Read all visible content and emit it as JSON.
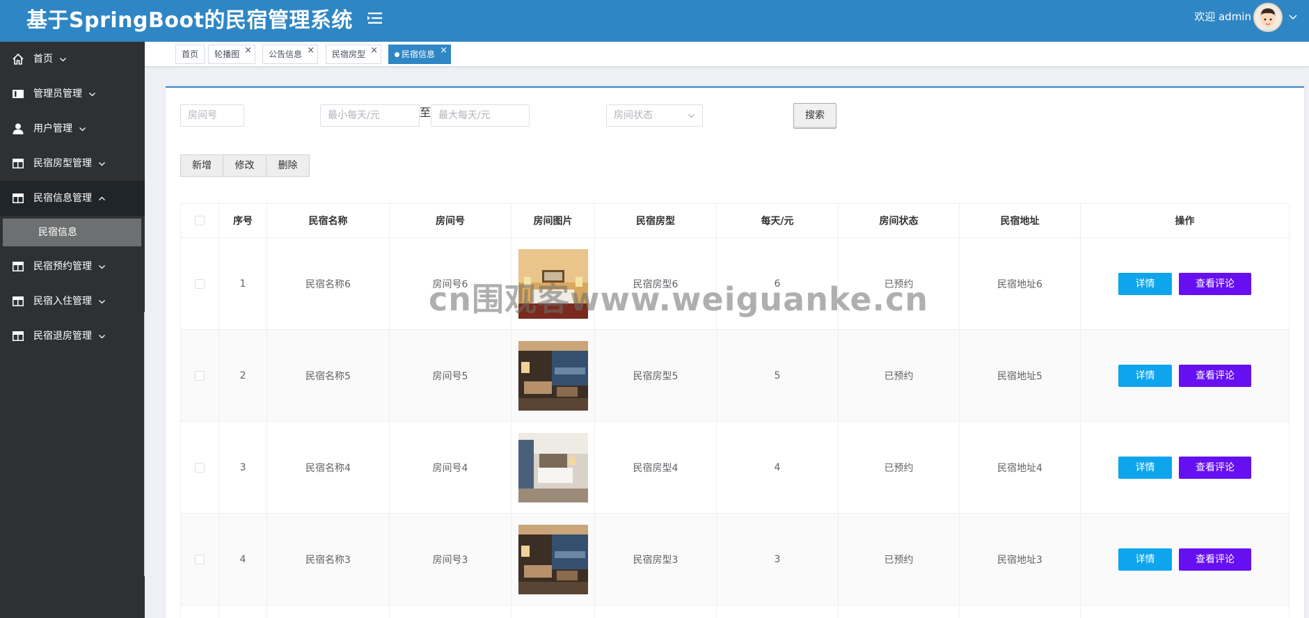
{
  "app": {
    "title": "基于SpringBoot的民宿管理系统",
    "welcome": "欢迎 admin"
  },
  "sidebar": {
    "items": [
      {
        "label": "首页",
        "icon": "home-icon"
      },
      {
        "label": "管理员管理",
        "icon": "card-icon"
      },
      {
        "label": "用户管理",
        "icon": "user-icon"
      },
      {
        "label": "民宿房型管理",
        "icon": "table-icon"
      },
      {
        "label": "民宿信息管理",
        "icon": "table-icon"
      },
      {
        "label": "民宿预约管理",
        "icon": "table-icon"
      },
      {
        "label": "民宿入住管理",
        "icon": "table-icon"
      },
      {
        "label": "民宿退房管理",
        "icon": "table-icon"
      }
    ],
    "sub_item": "民宿信息"
  },
  "tags": [
    {
      "label": "首页",
      "closable": false
    },
    {
      "label": "轮播图",
      "closable": true
    },
    {
      "label": "公告信息",
      "closable": true
    },
    {
      "label": "民宿房型",
      "closable": true
    },
    {
      "label": "民宿信息",
      "closable": true,
      "active": true
    }
  ],
  "search": {
    "room_placeholder": "房间号",
    "min_price_placeholder": "最小每天/元",
    "to_label": "至",
    "max_price_placeholder": "最大每天/元",
    "status_placeholder": "房间状态",
    "search_button": "搜索"
  },
  "actions": {
    "add": "新增",
    "edit": "修改",
    "delete": "删除"
  },
  "table": {
    "headers": [
      "序号",
      "民宿名称",
      "房间号",
      "房间图片",
      "民宿房型",
      "每天/元",
      "房间状态",
      "民宿地址",
      "操作"
    ],
    "rows": [
      {
        "index": "1",
        "name": "民宿名称6",
        "room": "房间号6",
        "type": "民宿房型6",
        "price": "6",
        "status": "已预约",
        "address": "民宿地址6"
      },
      {
        "index": "2",
        "name": "民宿名称5",
        "room": "房间号5",
        "type": "民宿房型5",
        "price": "5",
        "status": "已预约",
        "address": "民宿地址5"
      },
      {
        "index": "3",
        "name": "民宿名称4",
        "room": "房间号4",
        "type": "民宿房型4",
        "price": "4",
        "status": "已预约",
        "address": "民宿地址4"
      },
      {
        "index": "4",
        "name": "民宿名称3",
        "room": "房间号3",
        "type": "民宿房型3",
        "price": "3",
        "status": "已预约",
        "address": "民宿地址3"
      }
    ],
    "detail_button": "详情",
    "review_button": "查看评论"
  },
  "watermark": "cn围观客www.weiguanke.cn",
  "colors": {
    "header": "#2f86c4",
    "sidebar": "#2e3133",
    "detail": "#0ea5ec",
    "review": "#6610f2"
  }
}
